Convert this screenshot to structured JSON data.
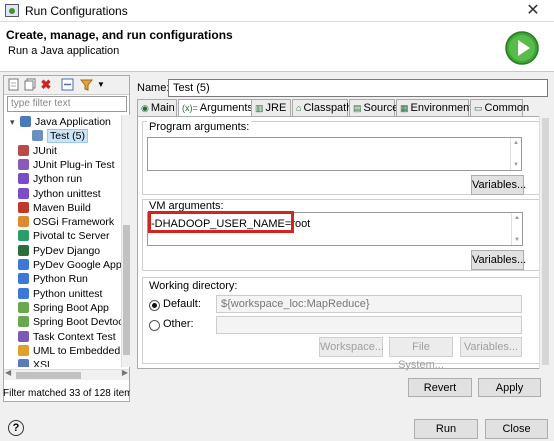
{
  "window": {
    "title": "Run Configurations",
    "close_glyph": "✕"
  },
  "header": {
    "heading": "Create, manage, and run configurations",
    "subheading": "Run a Java application"
  },
  "left": {
    "filter_placeholder": "type filter text",
    "tree": [
      {
        "label": "Java Application",
        "icon": "java-app-icon",
        "color": "#4a7ab8",
        "indent": 0,
        "expand": "▾"
      },
      {
        "label": "Test (5)",
        "icon": "java-config-icon",
        "color": "#6a8fc0",
        "indent": 1,
        "selected": true
      },
      {
        "label": "JUnit",
        "icon": "junit-icon",
        "color": "#b84a4a"
      },
      {
        "label": "JUnit Plug-in Test",
        "icon": "junit-plugin-icon",
        "color": "#8a5ab8"
      },
      {
        "label": "Jython run",
        "icon": "jython-run-icon",
        "color": "#7b4cc7"
      },
      {
        "label": "Jython unittest",
        "icon": "jython-unittest-icon",
        "color": "#7b4cc7"
      },
      {
        "label": "Maven Build",
        "icon": "maven-icon",
        "color": "#c0392b"
      },
      {
        "label": "OSGi Framework",
        "icon": "osgi-icon",
        "color": "#e08a2c"
      },
      {
        "label": "Pivotal tc Server",
        "icon": "pivotal-icon",
        "color": "#2a9d6a"
      },
      {
        "label": "PyDev Django",
        "icon": "pydev-django-icon",
        "color": "#2a6e3a"
      },
      {
        "label": "PyDev Google App E",
        "icon": "google-app-icon",
        "color": "#3b78d8"
      },
      {
        "label": "Python Run",
        "icon": "python-run-icon",
        "color": "#3b78d8"
      },
      {
        "label": "Python unittest",
        "icon": "python-unittest-icon",
        "color": "#3b78d8"
      },
      {
        "label": "Spring Boot App",
        "icon": "spring-boot-icon",
        "color": "#6aa84f"
      },
      {
        "label": "Spring Boot Devtoo",
        "icon": "spring-devtools-icon",
        "color": "#6aa84f"
      },
      {
        "label": "Task Context Test",
        "icon": "task-context-icon",
        "color": "#7a5ab8"
      },
      {
        "label": "UML to Embedded",
        "icon": "uml-icon",
        "color": "#e0a02c"
      },
      {
        "label": "XSL",
        "icon": "xsl-icon",
        "color": "#5a7ab8"
      }
    ],
    "filter_message": "Filter matched 33 of 128 items"
  },
  "config": {
    "name_label": "Name:",
    "name_value": "Test (5)",
    "tabs": [
      {
        "label": "Main",
        "icon": "main-tab-icon",
        "glyph": "◉"
      },
      {
        "label": "Arguments",
        "icon": "arguments-tab-icon",
        "glyph": "(x)="
      },
      {
        "label": "JRE",
        "icon": "jre-tab-icon",
        "glyph": "▥"
      },
      {
        "label": "Classpath",
        "icon": "classpath-tab-icon",
        "glyph": "⌂"
      },
      {
        "label": "Source",
        "icon": "source-tab-icon",
        "glyph": "▤"
      },
      {
        "label": "Environment",
        "icon": "environment-tab-icon",
        "glyph": "▦"
      },
      {
        "label": "Common",
        "icon": "common-tab-icon",
        "glyph": "▭"
      }
    ],
    "program_args_label": "Program arguments:",
    "program_args_value": "",
    "vm_args_label": "VM arguments:",
    "vm_args_value": "-DHADOOP_USER_NAME=root",
    "variables_label": "Variables...",
    "working_dir_label": "Working directory:",
    "default_label": "Default:",
    "default_value": "${workspace_loc:MapReduce}",
    "other_label": "Other:",
    "workspace_button": "Workspace...",
    "filesystem_button": "File System...",
    "revert_button": "Revert",
    "apply_button": "Apply"
  },
  "footer": {
    "run_button": "Run",
    "close_button": "Close",
    "help_glyph": "?"
  },
  "colors": {
    "highlight": "#d0261f",
    "run_green": "#3fa535"
  }
}
